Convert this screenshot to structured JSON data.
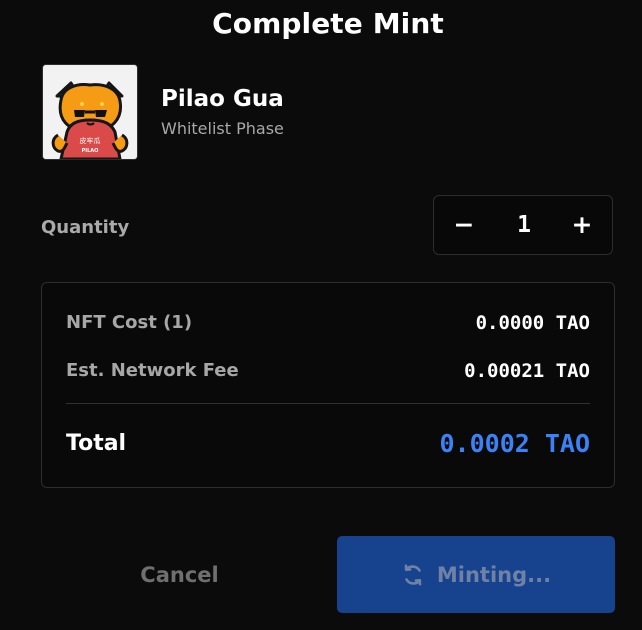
{
  "dialog": {
    "title": "Complete Mint"
  },
  "collection": {
    "name": "Pilao Gua",
    "phase": "Whitelist Phase",
    "avatar_icon": "orange-cat-with-sunglasses-icon",
    "avatar_shirt_text": "PILAO",
    "avatar_shirt_top_text": "皮牢瓜"
  },
  "quantity": {
    "label": "Quantity",
    "decrement_symbol": "−",
    "value": "1",
    "increment_symbol": "+"
  },
  "summary": {
    "nft_cost_label": "NFT Cost (1)",
    "nft_cost_value": "0.0000 TAO",
    "network_fee_label": "Est. Network Fee",
    "network_fee_value": "0.00021 TAO",
    "total_label": "Total",
    "total_value": "0.0002 TAO"
  },
  "actions": {
    "cancel_label": "Cancel",
    "minting_label": "Minting...",
    "spinner_icon": "loading-sync-icon"
  },
  "colors": {
    "background": "#0b0b0b",
    "border": "#2d2d2d",
    "total_accent": "#3b82f6",
    "minting_button": "#16428e",
    "muted_text": "#a7a7a7"
  }
}
